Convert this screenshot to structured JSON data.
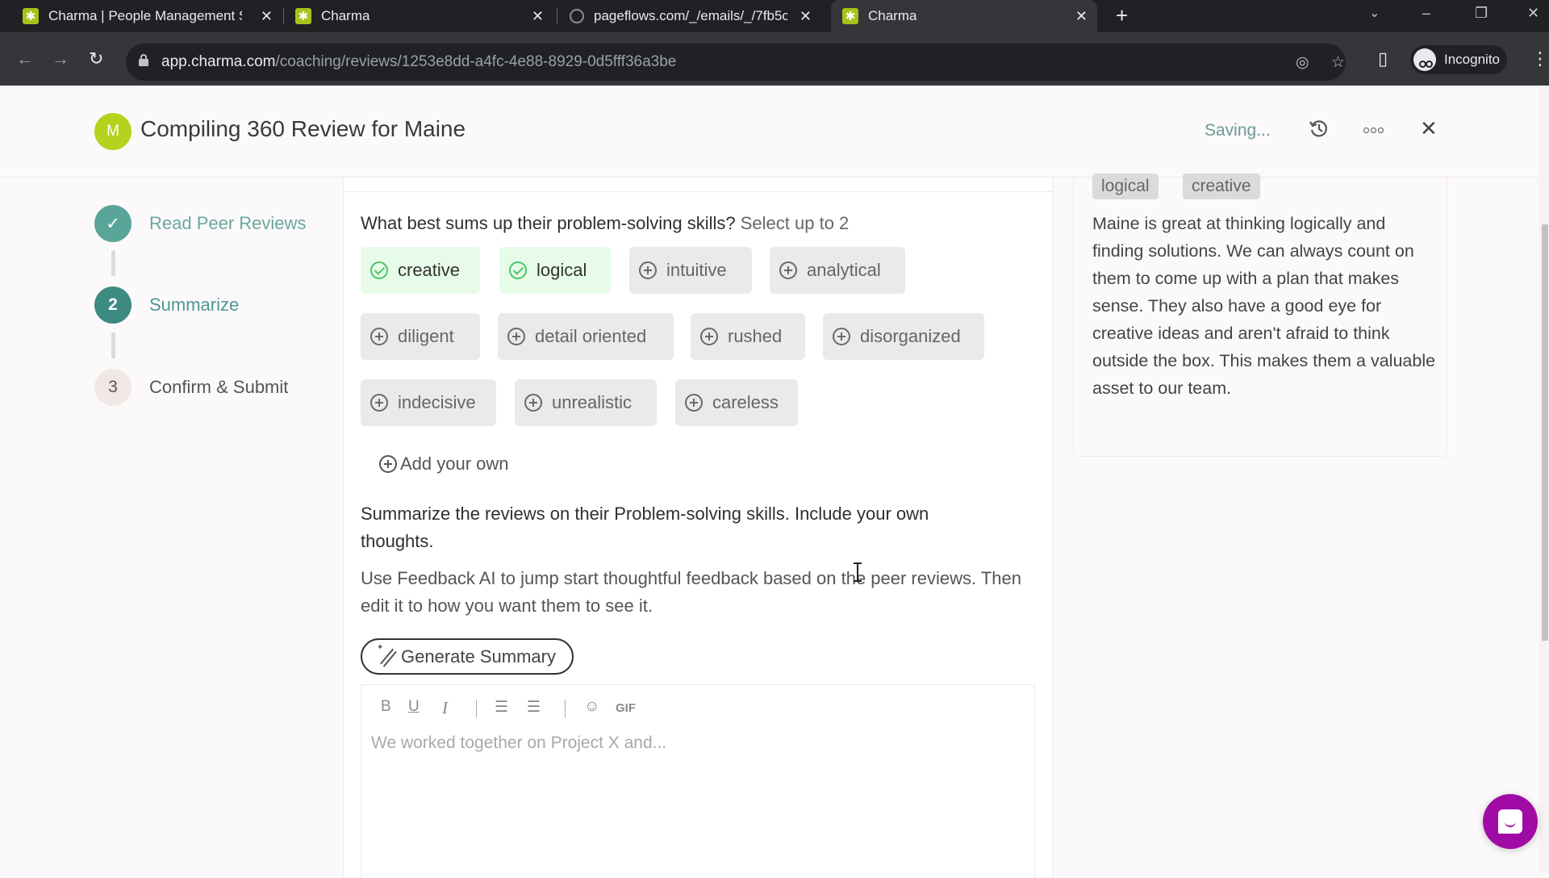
{
  "browser": {
    "tabs": [
      {
        "title": "Charma | People Management S",
        "favicon": "charma-logo"
      },
      {
        "title": "Charma",
        "favicon": "charma-logo"
      },
      {
        "title": "pageflows.com/_/emails/_/7fb5c",
        "favicon": "globe-icon"
      },
      {
        "title": "Charma",
        "favicon": "charma-logo",
        "active": true
      }
    ],
    "new_tab_label": "+",
    "url_domain": "app.charma.com",
    "url_path": "/coaching/reviews/1253e8dd-a4fc-4e88-8929-0d5fff36a3be",
    "profile_label": "Incognito"
  },
  "header": {
    "avatar_initial": "M",
    "title": "Compiling 360 Review for Maine",
    "status": "Saving..."
  },
  "steps": [
    {
      "number": "✓",
      "label": "Read Peer Reviews",
      "state": "done"
    },
    {
      "number": "2",
      "label": "Summarize",
      "state": "current"
    },
    {
      "number": "3",
      "label": "Confirm & Submit",
      "state": "todo"
    }
  ],
  "question": {
    "text": "What best sums up their problem-solving skills?",
    "hint": "Select up to 2",
    "max_select": 2
  },
  "chips": [
    {
      "label": "creative",
      "selected": true
    },
    {
      "label": "logical",
      "selected": true
    },
    {
      "label": "intuitive",
      "selected": false
    },
    {
      "label": "analytical",
      "selected": false
    },
    {
      "label": "diligent",
      "selected": false
    },
    {
      "label": "detail oriented",
      "selected": false
    },
    {
      "label": "rushed",
      "selected": false
    },
    {
      "label": "disorganized",
      "selected": false
    },
    {
      "label": "indecisive",
      "selected": false
    },
    {
      "label": "unrealistic",
      "selected": false
    },
    {
      "label": "careless",
      "selected": false
    }
  ],
  "add_own_label": "Add your own",
  "summary": {
    "prompt": "Summarize the reviews on their Problem-solving skills. Include your own thoughts.",
    "help": "Use Feedback AI to jump start thoughtful feedback based on the peer reviews. Then edit it to how you want them to see it.",
    "generate_label": "Generate Summary",
    "editor_placeholder": "We worked together on Project X and...",
    "toolbar": {
      "bold": "B",
      "underline": "U",
      "italic": "I",
      "bullet_list": "☰",
      "numbered_list": "☰",
      "emoji": "☺",
      "gif": "GIF"
    }
  },
  "peer_review": {
    "tags": [
      "logical",
      "creative"
    ],
    "text": "Maine is great at thinking logically and finding solutions. We can always count on them to come up with a plan that makes sense. They also have a good eye for creative ideas and aren't afraid to think outside the box. This makes them a valuable asset to our team."
  },
  "colors": {
    "brand_green": "#b5d21e",
    "step_teal": "#3c8a80",
    "selected_chip": "#e6fbe8",
    "chat_fab": "#a10ba5"
  }
}
